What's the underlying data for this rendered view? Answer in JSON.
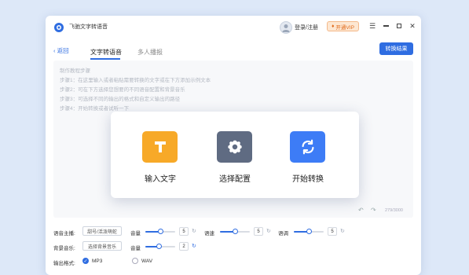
{
  "titlebar": {
    "app_title": "飞驰文字转语音",
    "login_label": "登录/注册",
    "vip_label": "开通VIP"
  },
  "tabs": {
    "back_label": "返回",
    "items": [
      {
        "label": "文字转语音",
        "active": true
      },
      {
        "label": "多人播报",
        "active": false
      }
    ],
    "convert_result_label": "转换结果"
  },
  "editor": {
    "hints": [
      "制作教程步骤",
      "步骤1：在这里输入或者粘贴需要转换的文字或在下方添加示例文本",
      "步骤2：可在下方选择您想要的不同语音配置和背景音乐",
      "步骤3：可选择不同的输出的格式和自定义输出的路径",
      "步骤4：开始转换或者试听一下"
    ],
    "counter": "279/3000"
  },
  "steps": [
    {
      "label": "输入文字",
      "icon": "text-t-icon",
      "color": "#f7a928"
    },
    {
      "label": "选择配置",
      "icon": "gear-icon",
      "color": "#5f6b82"
    },
    {
      "label": "开始转换",
      "icon": "convert-arrows-icon",
      "color": "#3d7cf6"
    }
  ],
  "controls": {
    "voice_label": "语音主播:",
    "voice_value": "甜号/活泼萌蛇",
    "volume_label": "音量",
    "volume_value": "5",
    "volume_level": 0.5,
    "speed_label": "语速",
    "speed_value": "5",
    "speed_level": 0.5,
    "pitch_label": "语调",
    "pitch_value": "5",
    "pitch_level": 0.5,
    "bgm_label": "背景音乐:",
    "bgm_value": "选择背景音乐",
    "bgm_volume_label": "音量",
    "bgm_volume_value": "2",
    "bgm_volume_level": 0.45,
    "format_label": "输出格式:",
    "formats": [
      {
        "label": "MP3",
        "selected": true
      },
      {
        "label": "WAV",
        "selected": false
      }
    ]
  },
  "colors": {
    "accent": "#2f6de1",
    "background": "#dde8f8"
  }
}
